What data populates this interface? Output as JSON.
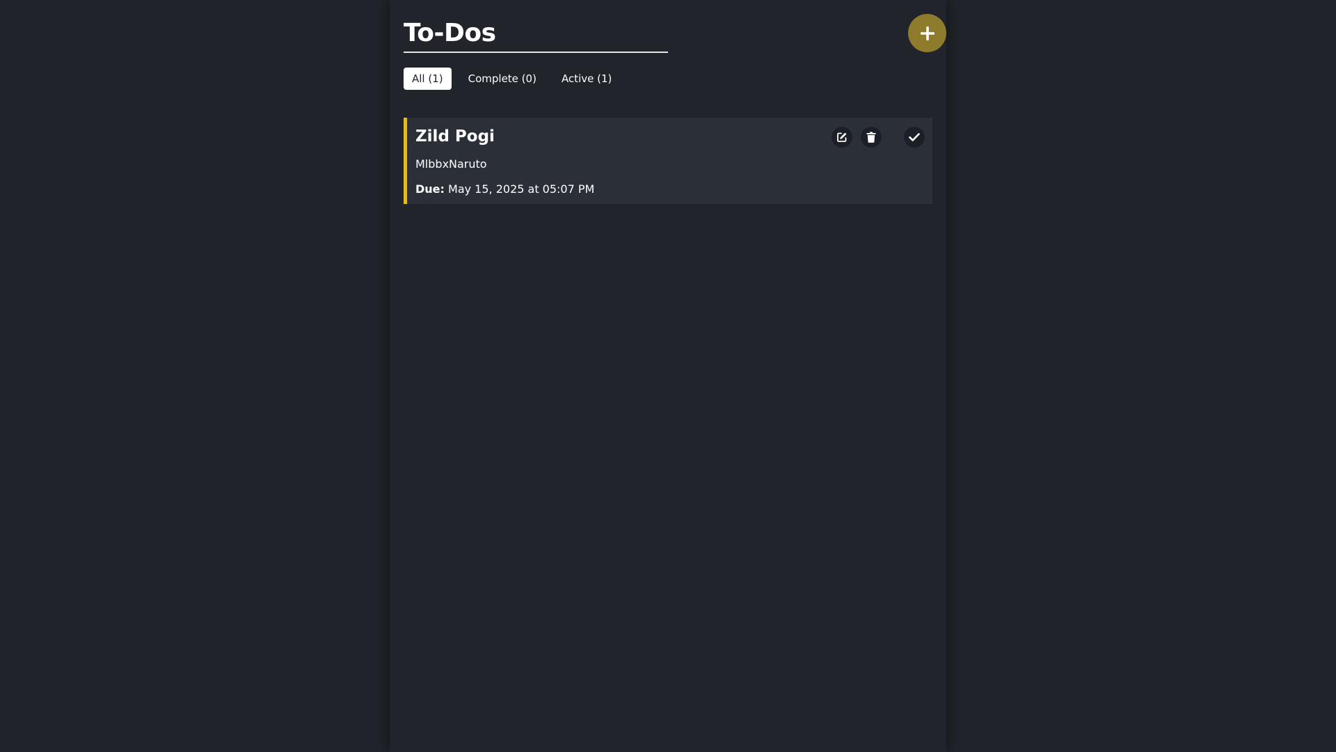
{
  "header": {
    "title": "To-Dos",
    "add_button_icon": "plus-icon"
  },
  "filters": [
    {
      "label": "All (1)",
      "active": true
    },
    {
      "label": "Complete (0)",
      "active": false
    },
    {
      "label": "Active (1)",
      "active": false
    }
  ],
  "todos": [
    {
      "title": "Zild Pogi",
      "description": "MlbbxNaruto",
      "due_label": "Due:",
      "due_value": "May 15, 2025 at 05:07 PM",
      "actions": [
        "edit-icon",
        "trash-icon",
        "check-icon"
      ]
    }
  ],
  "colors": {
    "background": "#20232a",
    "panel": "#21242b",
    "card": "#2b3038",
    "accent": "#e0bb2b",
    "add_button": "#8e7b2c",
    "text": "#ffffff"
  }
}
